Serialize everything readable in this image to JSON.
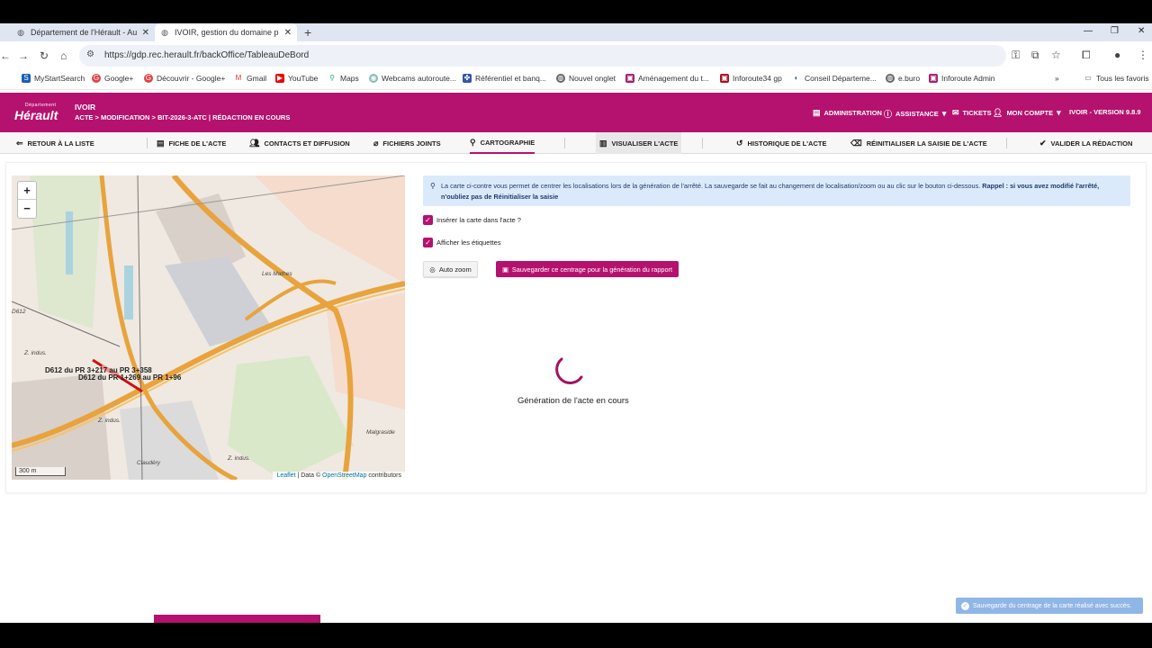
{
  "browser": {
    "tabs": [
      {
        "title": "Département de l'Hérault - Aut"
      },
      {
        "title": "IVOIR, gestion du domaine pub"
      }
    ],
    "new_tab": "+",
    "url": "https://gdp.rec.herault.fr/backOffice/TableauDeBord",
    "bookmarks": [
      "MyStartSearch",
      "Google+",
      "Découvrir - Google+",
      "Gmail",
      "YouTube",
      "Maps",
      "Webcams autoroute...",
      "Référentiel et banq...",
      "Nouvel onglet",
      "Aménagement du t...",
      "Inforoute34 gp",
      "Conseil Départeme...",
      "e.buro",
      "Inforoute Admin"
    ],
    "all_favorites": "Tous les favoris",
    "more": "»"
  },
  "app": {
    "logo_top": "Département",
    "logo_main": "Hérault",
    "title": "IVOIR",
    "breadcrumb": "ACTE > MODIFICATION > BIT-2026-3-ATC | RÉDACTION EN COURS",
    "header_links": {
      "admin": "ADMINISTRATION",
      "assist": "ASSISTANCE",
      "tickets": "TICKETS",
      "account": "MON COMPTE",
      "version": "IVOIR - VERSION 9.8.9"
    },
    "subnav": [
      "RETOUR À LA LISTE",
      "FICHE DE L'ACTE",
      "CONTACTS ET DIFFUSION",
      "FICHIERS JOINTS",
      "CARTOGRAPHIE",
      "VISUALISER L'ACTE",
      "HISTORIQUE DE L'ACTE",
      "RÉINITIALISER LA SAISIE DE L'ACTE",
      "VALIDER LA RÉDACTION"
    ]
  },
  "map": {
    "zoom_in": "+",
    "zoom_out": "−",
    "scale": "300 m",
    "attrib_leaflet": "Leaflet",
    "attrib_mid": " | Data © ",
    "attrib_osm": "OpenStreetMap",
    "attrib_end": " contributors",
    "labels": [
      "Les Mathes",
      "D612",
      "Z. indus.",
      "Z. indus.",
      "Malgraside",
      "Claudéry",
      "Z. indus."
    ],
    "tooltips": [
      "D612 du PR 3+217 au PR 3+358",
      "D612 du PR 1+269 au PR 1+96"
    ]
  },
  "panel": {
    "info_text": "La carte ci-contre vous permet de centrer les localisations lors de la génération de l'arrêté. La sauvegarde se fait au changement de localisation/zoom ou au clic sur le bouton ci-dessous.",
    "info_bold": "Rappel : si vous avez modifié l'arrêté, n'oubliez pas de Réinitialiser la saisie",
    "check1": "Insérer la carte dans l'acte ?",
    "check2": "Afficher les étiquettes",
    "auto_zoom": "Auto zoom",
    "save_btn": "Sauvegarder ce centrage pour la génération du rapport",
    "generating": "Génération de l'acte en cours"
  },
  "toast": "Sauvegarde du centrage de la carte réalisé avec succès.",
  "colors": {
    "brand": "#b5126f",
    "info_bg": "#dbeafa",
    "toast": "#8fb6e6"
  }
}
